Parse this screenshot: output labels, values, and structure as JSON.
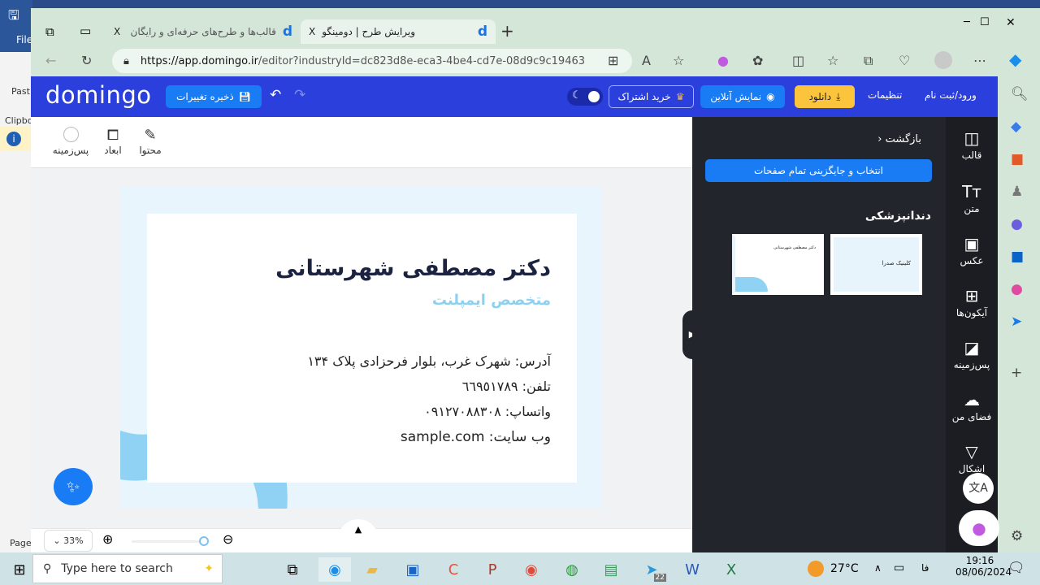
{
  "word": {
    "file": "File",
    "paste": "Past",
    "clipboard": "Clipbo",
    "page": "Page"
  },
  "browser": {
    "tabs": [
      {
        "title": "قالب‌ها و طرح‌های حرفه‌ای و رایگان",
        "close": "X"
      },
      {
        "title": "ویرایش طرح | دومینگو",
        "close": "X"
      }
    ],
    "new_tab": "+",
    "url_host": "https://app.domingo.ir",
    "url_path": "/editor?industryId=dc823d8e-eca3-4be4-cd7e-08d9c9c19463",
    "window_controls": [
      "─",
      "☐",
      "✕"
    ]
  },
  "header": {
    "logo": "domingo",
    "save": "ذخیره تغییرات",
    "subscribe": "خرید اشتراک",
    "preview": "نمایش آنلاین",
    "download": "دانلود",
    "settings": "تنظیمات",
    "login": "ورود/ثبت نام",
    "accent": "#2a3fdc",
    "download_color": "#fcc43d"
  },
  "toolbar": {
    "content": "محتوا",
    "dimensions": "ابعاد",
    "background": "پس‌زمینه"
  },
  "card": {
    "name": "دکتر مصطفی شهرستانی",
    "title": "متخصص ایمپلنت",
    "address": "آدرس: شهرک غرب، بلوار فرحزادی پلاک ۱۳۴",
    "phone": "تلفن: ٦٦٩٥١٧٨٩",
    "whatsapp": "واتساپ: ۰۹۱۲۷۰۸۸۳۰۸",
    "website": "وب سایت: sample.com"
  },
  "panel": {
    "back": "بازگشت",
    "replace_all": "انتخاب و جایگزینی تمام صفحات",
    "category": "دندانپزشکی",
    "thumb1_title": "کلینیک صدرا",
    "thumb2_title": "دکتر مصطفی شهرستانی"
  },
  "nav": [
    {
      "label": "قالب",
      "icon": "layout-icon"
    },
    {
      "label": "متن",
      "icon": "text-icon"
    },
    {
      "label": "عکس",
      "icon": "image-icon"
    },
    {
      "label": "آیکون‌ها",
      "icon": "grid-icon"
    },
    {
      "label": "پس‌زمینه",
      "icon": "background-icon"
    },
    {
      "label": "فضای من",
      "icon": "cloud-upload-icon"
    },
    {
      "label": "اشکال",
      "icon": "shapes-icon"
    }
  ],
  "zoom": {
    "level": "33%",
    "value": 33
  },
  "taskbar": {
    "search_placeholder": "Type here to search",
    "temp": "27°C",
    "lang": "فا",
    "time": "19:16",
    "date": "08/06/2024",
    "telegram_badge": "22"
  }
}
